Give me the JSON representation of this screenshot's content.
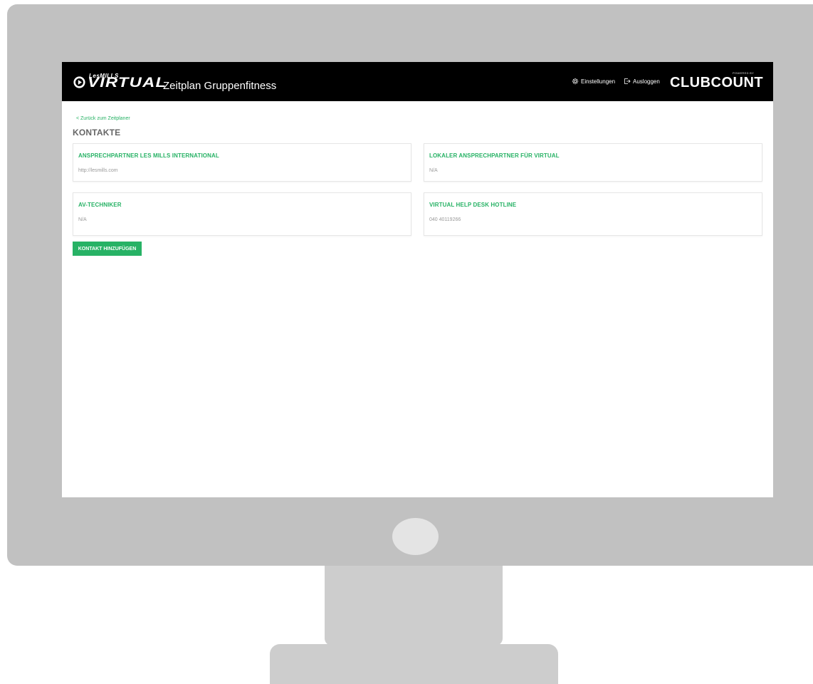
{
  "header": {
    "logo_small": "LesMILLS",
    "logo_big": "VIRTUAL",
    "app_title": "Zeitplan Gruppenfitness",
    "settings_label": "Einstellungen",
    "logout_label": "Ausloggen",
    "powered_by": "POWERED BY",
    "brand": "CLUBCOUNT"
  },
  "main": {
    "back_link": "< Zurück zum Zeitplaner",
    "page_title": "KONTAKTE",
    "contacts": [
      {
        "title": "ANSPRECHPARTNER LES MILLS INTERNATIONAL",
        "value": "http://lesmills.com"
      },
      {
        "title": "LOKALER ANSPRECHPARTNER FÜR VIRTUAL",
        "value": "N/A"
      },
      {
        "title": "AV-TECHNIKER",
        "value": "N/A"
      },
      {
        "title": "VIRTUAL HELP DESK HOTLINE",
        "value": "040 40119266"
      }
    ],
    "add_button": "KONTAKT HINZUFÜGEN"
  },
  "colors": {
    "accent": "#27b265",
    "header_bg": "#000000",
    "bezel": "#c1c1c1"
  }
}
